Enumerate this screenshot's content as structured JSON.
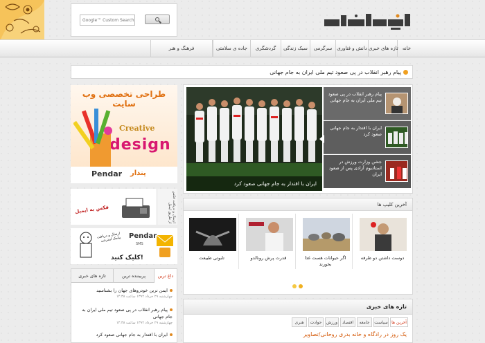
{
  "header": {
    "search_placeholder": "Google™ Custom Search",
    "logo_alt": "site-logo"
  },
  "nav": {
    "items": [
      {
        "label": "خانه"
      },
      {
        "label": "تازه های خبری"
      },
      {
        "label": "دانش و فناوری"
      },
      {
        "label": "سرگرمی"
      },
      {
        "label": "سبک زندگی"
      },
      {
        "label": "گردشگری"
      },
      {
        "label": "جاده ی سلامتی"
      },
      {
        "label": "فرهنگ و هنر"
      }
    ]
  },
  "ticker": {
    "text": "پیام رهبر انقلاب در پی صعود تیم ملی ایران به جام جهانی"
  },
  "banners": {
    "design_title": "طراحی تخصصی وب سایت",
    "design_creative": "Creative",
    "design_word": "design",
    "design_brand": "Pendar",
    "design_brand_fa": "پندار",
    "fax_text": "فکس به ایمیل",
    "fax_side": "ارسال و دریافت فکس از طریق ایمیل",
    "sms_brand": "Pendar",
    "sms_sub": "SMS",
    "sms_cta": "کلیک کنید!",
    "sms_text": "ارسال و دریافت پیامک اینترنتی"
  },
  "left_tabs": {
    "tabs": [
      {
        "label": "داغ ترین"
      },
      {
        "label": "پربیننده ترین"
      },
      {
        "label": "تازه های خبری"
      }
    ],
    "items": [
      {
        "title": "ایمن ترین خودروهای جهان را بشناسید",
        "date": "چهارشنبه ۲۹ خرداد ۱۳۹۲ ساعت ۱۴:۳۸"
      },
      {
        "title": "پیام رهبر انقلاب در پی صعود تیم ملی ایران به جام جهانی",
        "date": "چهارشنبه ۲۹ خرداد ۱۳۹۲ ساعت ۱۴:۳۸"
      },
      {
        "title": "ایران با اقتدار به جام جهانی صعود کرد",
        "date": ""
      }
    ]
  },
  "slider": {
    "caption": "ایران با اقتدار به جام جهانی صعود کرد",
    "items": [
      {
        "title": "پیام رهبر انقلاب در پی صعود تیم ملی ایران به جام جهانی"
      },
      {
        "title": "ایران با اقتدار به جام جهانی صعود کرد"
      },
      {
        "title": "جشن وزارت ورزش در استادیوم آزادی پس از صعود ایران"
      }
    ]
  },
  "clips": {
    "title": "آخرین کلیپ ها",
    "items": [
      {
        "caption": "دوست داشتن دو طرفه"
      },
      {
        "caption": "اگر حیوانات هست غذا بخورند"
      },
      {
        "caption": "قدرت پرش رونالدو"
      },
      {
        "caption": "تابوتی طبیعت"
      }
    ]
  },
  "latest_news": {
    "title": "تازه های خبری",
    "categories": [
      {
        "label": "آخرین ها"
      },
      {
        "label": "سیاست"
      },
      {
        "label": "جامعه"
      },
      {
        "label": "اقتصاد"
      },
      {
        "label": "ورزش"
      },
      {
        "label": "حوادث"
      },
      {
        "label": "هنری"
      }
    ],
    "first": "یک روز در رادگاه و خانه بدری روحانی/تصاویر"
  },
  "colors": {
    "accent": "#d03010",
    "orange": "#f0a020",
    "brand": "#3b3b3b"
  }
}
